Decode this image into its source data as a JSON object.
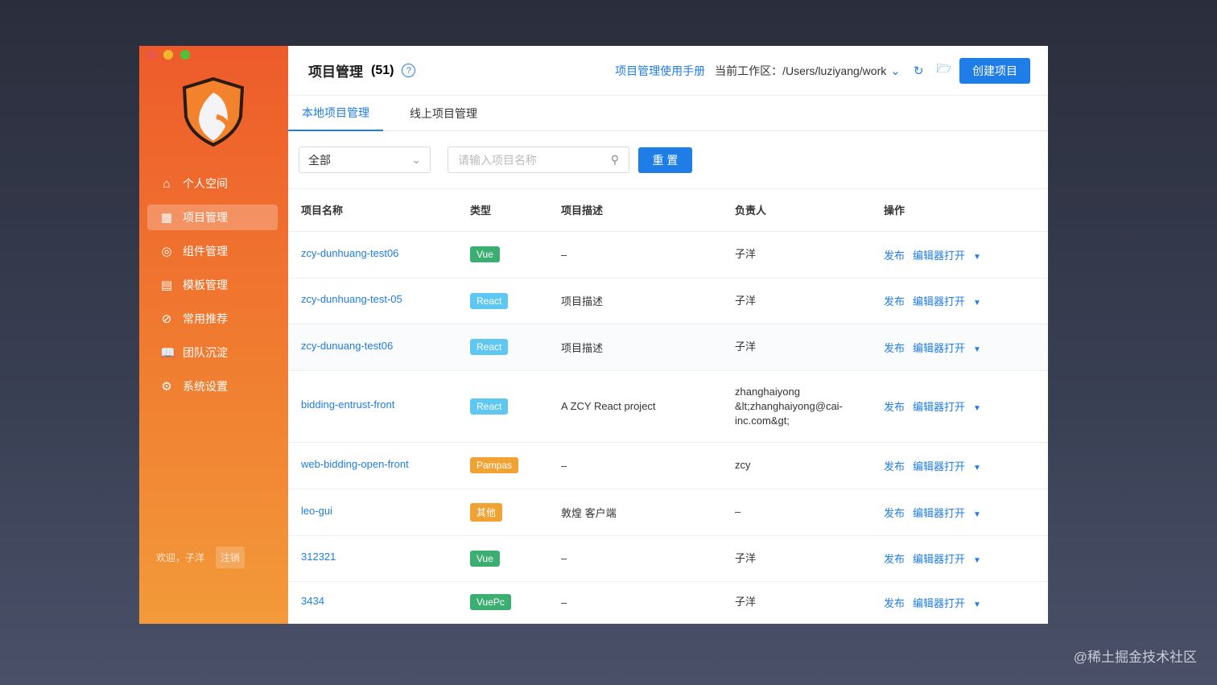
{
  "sidebar": {
    "items": [
      {
        "label": "个人空间",
        "icon": "home-icon"
      },
      {
        "label": "项目管理",
        "icon": "grid-icon",
        "active": true
      },
      {
        "label": "组件管理",
        "icon": "component-icon"
      },
      {
        "label": "模板管理",
        "icon": "template-icon"
      },
      {
        "label": "常用推荐",
        "icon": "compass-icon"
      },
      {
        "label": "团队沉淀",
        "icon": "book-icon"
      },
      {
        "label": "系统设置",
        "icon": "gear-icon"
      }
    ],
    "welcome": "欢迎，子洋",
    "logout": "注销"
  },
  "header": {
    "title": "项目管理",
    "count": "(51)",
    "manual_link": "项目管理使用手册",
    "workspace_label": "当前工作区：",
    "workspace_path": "/Users/luziyang/work",
    "create_button": "创建项目"
  },
  "tabs": [
    {
      "label": "本地项目管理"
    },
    {
      "label": "线上项目管理"
    }
  ],
  "filters": {
    "type_value": "全部",
    "search_placeholder": "请输入项目名称",
    "reset_button": "重 置"
  },
  "table": {
    "columns": [
      "项目名称",
      "类型",
      "项目描述",
      "负责人",
      "操作"
    ],
    "rows": [
      {
        "name": "zcy-dunhuang-test06",
        "type": "Vue",
        "type_color": "#3dae72",
        "desc": "–",
        "owner": "子洋"
      },
      {
        "name": "zcy-dunhuang-test-05",
        "type": "React",
        "type_color": "#5ec8f2",
        "desc": "项目描述",
        "owner": "子洋"
      },
      {
        "name": "zcy-dunuang-test06",
        "type": "React",
        "type_color": "#5ec8f2",
        "desc": "项目描述",
        "owner": "子洋"
      },
      {
        "name": "bidding-entrust-front",
        "type": "React",
        "type_color": "#5ec8f2",
        "desc": "A ZCY React project",
        "owner": "zhanghaiyong &lt;zhanghaiyong@cai-inc.com&gt;"
      },
      {
        "name": "web-bidding-open-front",
        "type": "Pampas",
        "type_color": "#f0a232",
        "desc": "–",
        "owner": "zcy"
      },
      {
        "name": "leo-gui",
        "type": "其他",
        "type_color": "#f0a232",
        "desc": "敦煌 客户端",
        "owner": "–"
      },
      {
        "name": "312321",
        "type": "Vue",
        "type_color": "#3dae72",
        "desc": "–",
        "owner": "子洋"
      },
      {
        "name": "3434",
        "type": "VuePc",
        "type_color": "#3dae72",
        "desc": "–",
        "owner": "子洋"
      }
    ],
    "action_publish": "发布",
    "action_editor": "编辑器打开"
  },
  "watermark": "@稀土掘金技术社区"
}
